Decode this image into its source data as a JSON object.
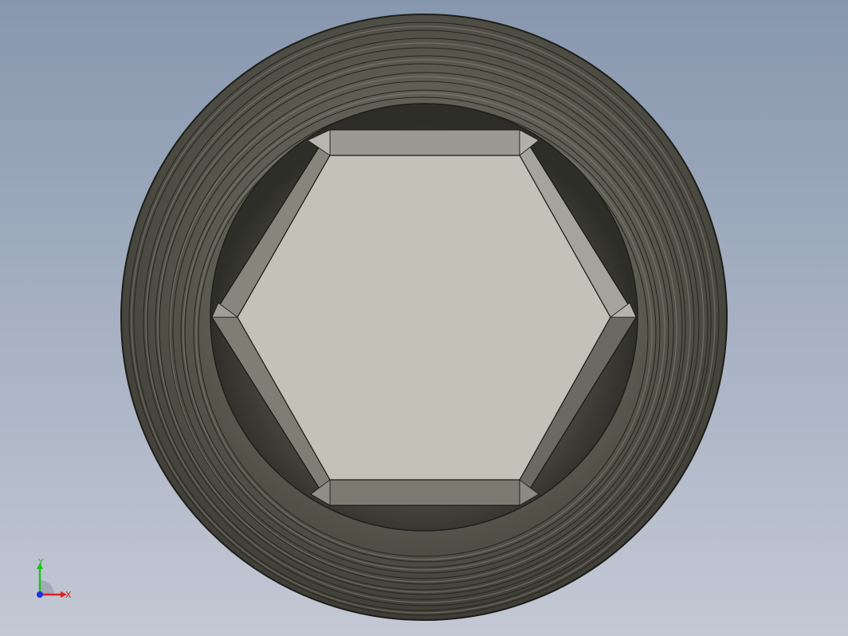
{
  "viewport": {
    "background_top": "#8797ae",
    "background_bottom": "#c3c8d4",
    "part_colors": {
      "thread_body": "#5c5c52",
      "socket_face": "#c2c2b8",
      "socket_wall_dark": "#6e6e66",
      "socket_wall_light": "#a2a29a"
    }
  },
  "triad": {
    "x_label": "X",
    "y_label": "Y",
    "x_color": "#e02020",
    "y_color": "#20c020",
    "z_color": "#2030e0"
  }
}
